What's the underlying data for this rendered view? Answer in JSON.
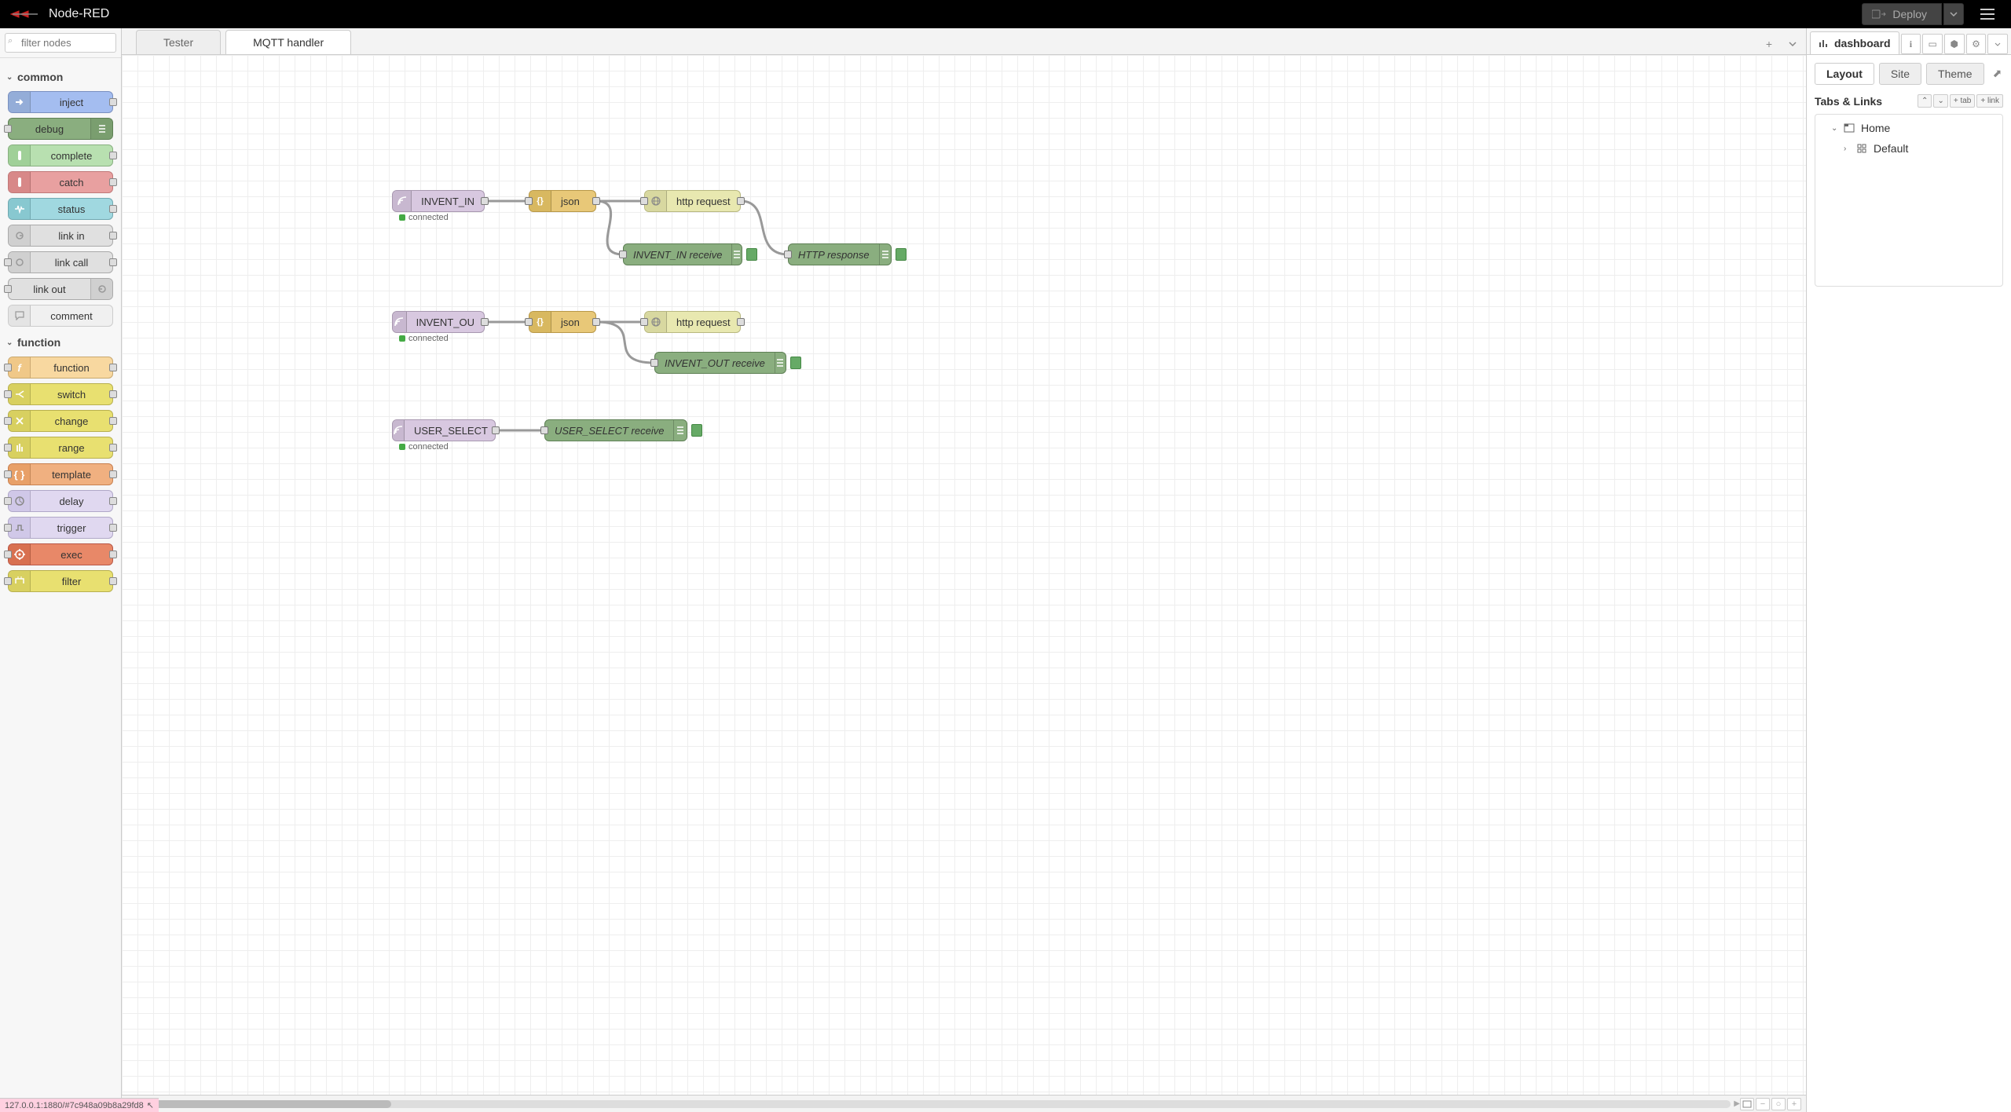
{
  "app": {
    "title": "Node-RED",
    "deploy_label": "Deploy"
  },
  "palette": {
    "filter_placeholder": "filter nodes",
    "categories": {
      "common": {
        "label": "common",
        "nodes": {
          "inject": "inject",
          "debug": "debug",
          "complete": "complete",
          "catch": "catch",
          "status": "status",
          "link_in": "link in",
          "link_call": "link call",
          "link_out": "link out",
          "comment": "comment"
        }
      },
      "function": {
        "label": "function",
        "nodes": {
          "function": "function",
          "switch": "switch",
          "change": "change",
          "range": "range",
          "template": "template",
          "delay": "delay",
          "trigger": "trigger",
          "exec": "exec",
          "filter": "filter"
        }
      }
    }
  },
  "tabs": {
    "0": {
      "label": "Tester"
    },
    "1": {
      "label": "MQTT handler"
    }
  },
  "flow": {
    "invent_in": {
      "label": "INVENT_IN",
      "status": "connected"
    },
    "json1": {
      "label": "json"
    },
    "http1": {
      "label": "http request"
    },
    "dbg_invent_in": {
      "label": "INVENT_IN receive"
    },
    "dbg_http_resp": {
      "label": "HTTP response"
    },
    "invent_ou": {
      "label": "INVENT_OU",
      "status": "connected"
    },
    "json2": {
      "label": "json"
    },
    "http2": {
      "label": "http request"
    },
    "dbg_invent_out": {
      "label": "INVENT_OUT receive"
    },
    "user_select": {
      "label": "USER_SELECT",
      "status": "connected"
    },
    "dbg_user_select": {
      "label": "USER_SELECT receive"
    }
  },
  "sidebar": {
    "main_tab": "dashboard",
    "subtabs": {
      "layout": "Layout",
      "site": "Site",
      "theme": "Theme"
    },
    "tabs_links_title": "Tabs & Links",
    "add_tab": "tab",
    "add_link": "link",
    "tree": {
      "home": "Home",
      "default": "Default"
    }
  },
  "statusbar": {
    "text": "127.0.0.1:1880/#7c948a09b8a29fd8"
  }
}
